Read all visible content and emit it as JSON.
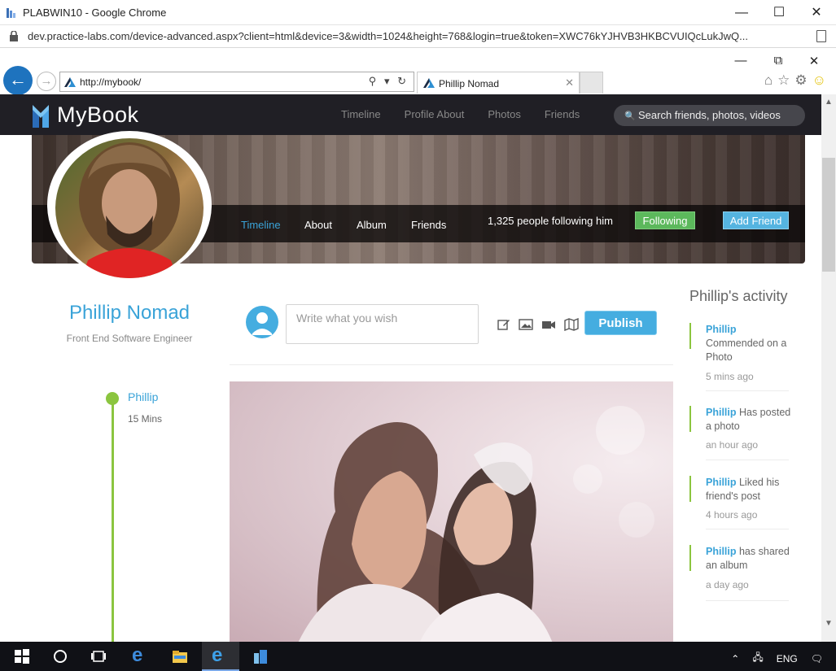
{
  "chrome": {
    "window_title": "PLABWIN10 - Google Chrome",
    "url": "dev.practice-labs.com/device-advanced.aspx?client=html&device=3&width=1024&height=768&login=true&token=XWC76kYJHVB3HKBCVUIQcLukJwQ..."
  },
  "ie": {
    "address": "http://mybook/",
    "tab_title": "Phillip Nomad"
  },
  "mybook": {
    "logo_text": "MyBook",
    "nav": [
      "Timeline",
      "Profile About",
      "Photos",
      "Friends"
    ],
    "search_placeholder": "Search friends, photos, videos"
  },
  "cover": {
    "tabs": [
      "Timeline",
      "About",
      "Album",
      "Friends"
    ],
    "active_tab": "Timeline",
    "followers_text": "1,325 people following him",
    "following_label": "Following",
    "add_friend_label": "Add Friend"
  },
  "profile": {
    "name": "Phillip Nomad",
    "role": "Front End Software Engineer"
  },
  "composer": {
    "placeholder": "Write what you wish",
    "publish_label": "Publish"
  },
  "timeline_post": {
    "author": "Phillip",
    "time": "15 Mins"
  },
  "activity": {
    "title": "Phillip's activity",
    "items": [
      {
        "who": "Phillip",
        "action": "Commended on a Photo",
        "when": "5 mins ago"
      },
      {
        "who": "Phillip",
        "action": "Has posted a photo",
        "when": "an hour ago"
      },
      {
        "who": "Phillip",
        "action": "Liked his friend's post",
        "when": "4 hours ago"
      },
      {
        "who": "Phillip",
        "action": "has shared an album",
        "when": "a day ago"
      }
    ]
  },
  "taskbar": {
    "language": "ENG"
  },
  "colors": {
    "accent_blue": "#3aa3d8",
    "accent_green": "#8bc53f",
    "nav_bg": "#201f25",
    "following_green": "#5cb85c",
    "add_friend_blue": "#55b4e0"
  }
}
